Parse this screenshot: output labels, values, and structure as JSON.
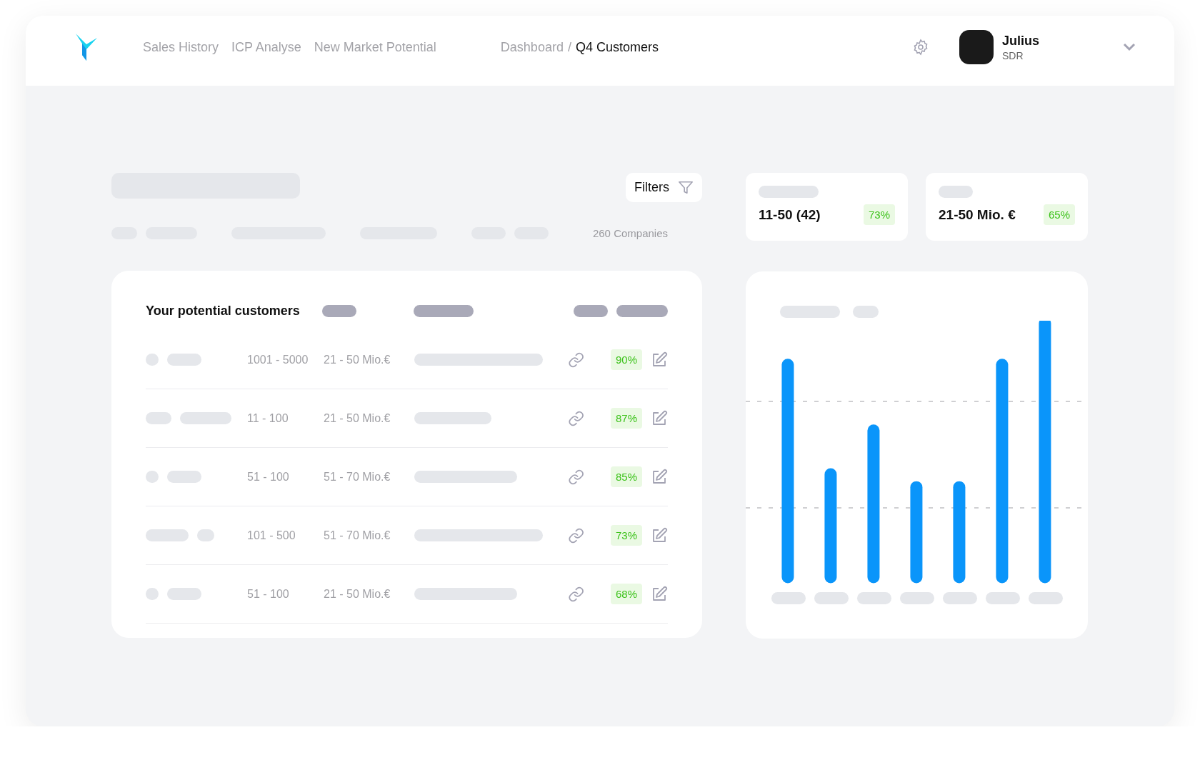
{
  "nav": {
    "links": [
      {
        "label": "Sales History"
      },
      {
        "label": "ICP Analyse"
      },
      {
        "label": "New Market Potential"
      }
    ],
    "breadcrumb_separator": "/",
    "breadcrumb": [
      {
        "label": "Dashboard"
      },
      {
        "label": "Q4 Customers"
      }
    ],
    "user": {
      "name": "Julius",
      "role": "SDR"
    }
  },
  "toolbar": {
    "filters_label": "Filters",
    "count": "260",
    "count_label": "Companies"
  },
  "stats": [
    {
      "value": "11-50 (42)",
      "percent": "73%"
    },
    {
      "value": "21-50 Mio. €",
      "percent": "65%"
    }
  ],
  "table": {
    "title": "Your potential customers",
    "rows": [
      {
        "size": "1001 - 5000",
        "revenue": "21 - 50 Mio.€",
        "match": "90%"
      },
      {
        "size": "11 - 100",
        "revenue": "21 - 50 Mio.€",
        "match": "87%"
      },
      {
        "size": "51 - 100",
        "revenue": "51 - 70 Mio.€",
        "match": "85%"
      },
      {
        "size": "101 - 500",
        "revenue": "51 - 70 Mio.€",
        "match": "73%"
      },
      {
        "size": "51 - 100",
        "revenue": "21 - 50 Mio.€",
        "match": "68%"
      }
    ]
  }
}
